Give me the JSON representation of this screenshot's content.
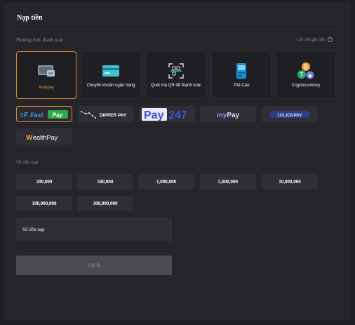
{
  "header": {
    "title": "Nạp tiền"
  },
  "payment": {
    "section_label": "Phương thức thanh toán",
    "detail_link": "Chi tiết gửi tiền",
    "methods": [
      {
        "label": "Autopay",
        "icon": "wallet-card-icon",
        "active": true
      },
      {
        "label": "Chuyển khoản ngân hàng",
        "icon": "bank-card-icon",
        "active": false
      },
      {
        "label": "Quét mã QR để thanh toán",
        "icon": "qr-scan-icon",
        "active": false
      },
      {
        "label": "Thẻ Cào",
        "icon": "scratch-card-icon",
        "active": false
      },
      {
        "label": "Cryptocurrency",
        "icon": "crypto-coins-icon",
        "active": false
      }
    ],
    "providers": [
      {
        "name": "FastPay",
        "active": true
      },
      {
        "name": "DIPPER PAY",
        "active": false
      },
      {
        "name": "Pay247",
        "active": false
      },
      {
        "name": "myPay",
        "active": false
      },
      {
        "name": "1CLICKPAY",
        "active": false
      },
      {
        "name": "WealthPay",
        "active": false
      }
    ]
  },
  "amount": {
    "section_label": "Số tiền nạp",
    "options": [
      "200,000",
      "500,000",
      "1,000,000",
      "5,000,000",
      "10,000,000",
      "100,000,000",
      "300,000,000"
    ],
    "input_placeholder": "Số tiền nạp",
    "submit_label": "Gửi đi"
  },
  "colors": {
    "accent": "#d98a3c",
    "background": "#252529",
    "tile": "#2e2e34"
  }
}
